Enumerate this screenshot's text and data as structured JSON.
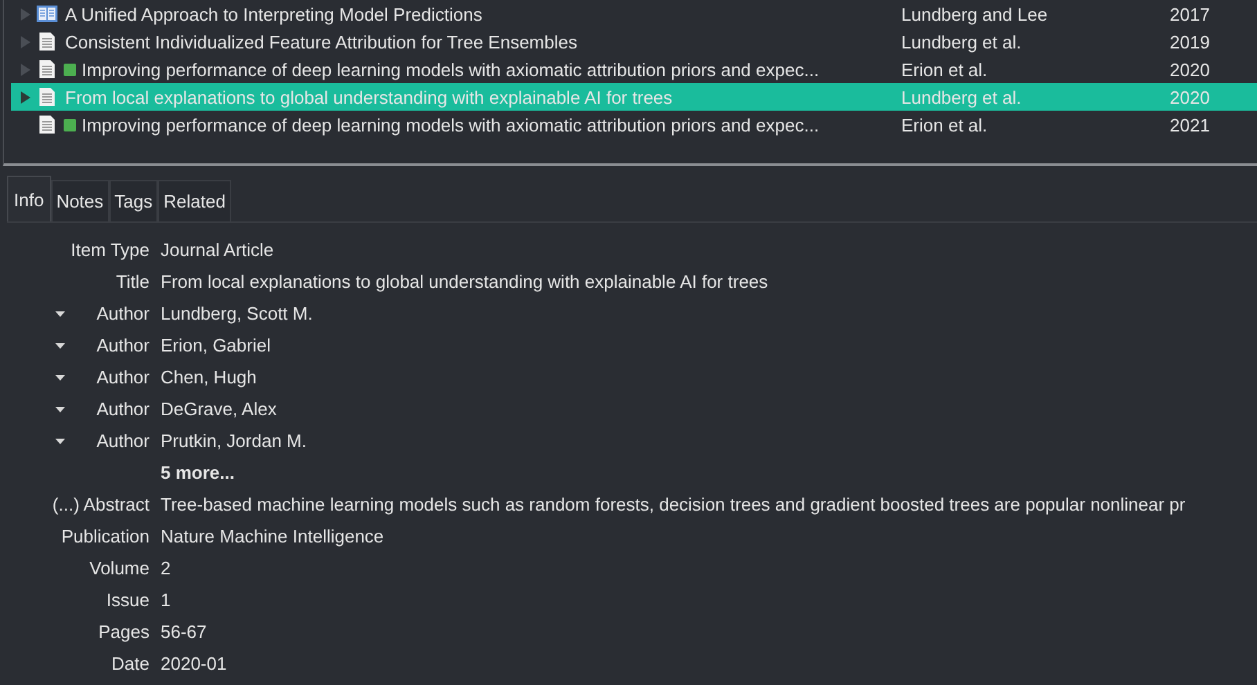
{
  "items_table": {
    "rows": [
      {
        "kind": "book",
        "expandable": true,
        "attachment": false,
        "selected": false,
        "title": "A Unified Approach to Interpreting Model Predictions",
        "creator": "Lundberg and Lee",
        "year": "2017"
      },
      {
        "kind": "document",
        "expandable": true,
        "attachment": false,
        "selected": false,
        "title": "Consistent Individualized Feature Attribution for Tree Ensembles",
        "creator": "Lundberg et al.",
        "year": "2019"
      },
      {
        "kind": "document",
        "expandable": true,
        "attachment": true,
        "selected": false,
        "title": "Improving performance of deep learning models with axiomatic attribution priors and expec...",
        "creator": "Erion et al.",
        "year": "2020"
      },
      {
        "kind": "document",
        "expandable": true,
        "attachment": false,
        "selected": true,
        "title": "From local explanations to global understanding with explainable AI for trees",
        "creator": "Lundberg et al.",
        "year": "2020"
      },
      {
        "kind": "document",
        "expandable": false,
        "attachment": true,
        "selected": false,
        "title": "Improving performance of deep learning models with axiomatic attribution priors and expec...",
        "creator": "Erion et al.",
        "year": "2021"
      }
    ]
  },
  "tabs": [
    {
      "label": "Info",
      "selected": true
    },
    {
      "label": "Notes",
      "selected": false
    },
    {
      "label": "Tags",
      "selected": false
    },
    {
      "label": "Related",
      "selected": false
    }
  ],
  "fields": [
    {
      "kind": "plain",
      "label": "Item Type",
      "value": "Journal Article"
    },
    {
      "kind": "plain",
      "label": "Title",
      "value": "From local explanations to global understanding with explainable AI for trees"
    },
    {
      "kind": "creator",
      "label": "Author",
      "value": "Lundberg, Scott M."
    },
    {
      "kind": "creator",
      "label": "Author",
      "value": "Erion, Gabriel"
    },
    {
      "kind": "creator",
      "label": "Author",
      "value": "Chen, Hugh"
    },
    {
      "kind": "creator",
      "label": "Author",
      "value": "DeGrave, Alex"
    },
    {
      "kind": "creator",
      "label": "Author",
      "value": "Prutkin, Jordan M."
    },
    {
      "kind": "more",
      "value": "5 more..."
    },
    {
      "kind": "plain",
      "label": "(...) Abstract",
      "value": "Tree-based machine learning models such as random forests, decision trees and gradient boosted trees are popular nonlinear pr"
    },
    {
      "kind": "plain",
      "label": "Publication",
      "value": "Nature Machine Intelligence"
    },
    {
      "kind": "plain",
      "label": "Volume",
      "value": "2"
    },
    {
      "kind": "plain",
      "label": "Issue",
      "value": "1"
    },
    {
      "kind": "plain",
      "label": "Pages",
      "value": "56-67"
    },
    {
      "kind": "plain",
      "label": "Date",
      "value": "2020-01"
    }
  ]
}
